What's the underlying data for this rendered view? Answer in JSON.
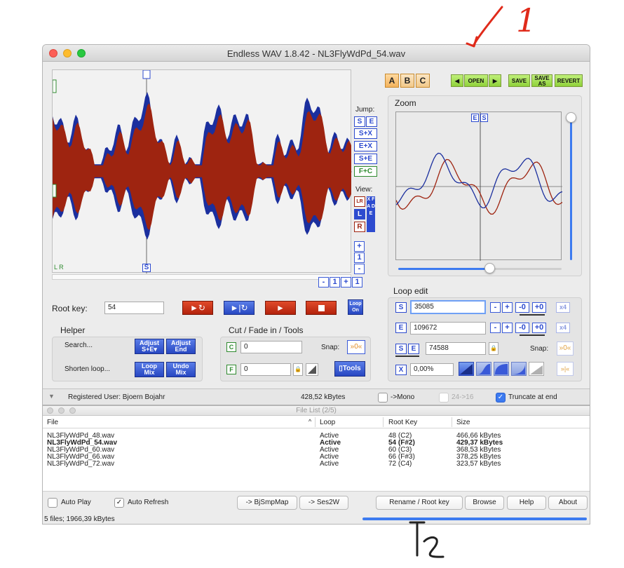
{
  "window": {
    "title": "Endless WAV 1.8.42 - NL3FlyWdPd_54.wav"
  },
  "toolbar": {
    "abc": [
      "A",
      "B",
      "C"
    ],
    "open": "OPEN",
    "save": "SAVE",
    "save_as_line1": "SAVE",
    "save_as_line2": "AS",
    "revert": "REVERT"
  },
  "jump": {
    "label": "Jump:",
    "s": "S",
    "e": "E",
    "sx": "S+X",
    "ex": "E+X",
    "se": "S+E",
    "fc": "F+C"
  },
  "view": {
    "label": "View:",
    "lr": "LR",
    "l": "L",
    "r": "R",
    "xfade": "X F A D E"
  },
  "zoom": {
    "label": "Zoom",
    "marker_e": "E",
    "marker_s": "S"
  },
  "waveform": {
    "marker_s": "S",
    "marker_lr": "L R",
    "zoom_plus": "+",
    "zoom_one": "1",
    "zoom_minus": "-"
  },
  "hzoom": {
    "minus": "-",
    "one": "1",
    "plus": "+",
    "one2": "1"
  },
  "root": {
    "label": "Root key:",
    "value": "54"
  },
  "loop_on": {
    "line1": "Loop",
    "line2": "On"
  },
  "helper": {
    "title": "Helper",
    "search": "Search...",
    "shorten": "Shorten loop...",
    "adjust_se_1": "Adjust",
    "adjust_se_2": "S+E▾",
    "adjust_end_1": "Adjust",
    "adjust_end_2": "End",
    "loop_mix_1": "Loop",
    "loop_mix_2": "Mix",
    "undo_mix_1": "Undo",
    "undo_mix_2": "Mix"
  },
  "cut": {
    "title": "Cut / Fade in / Tools",
    "c_label": "C",
    "c_value": "0",
    "f_label": "F",
    "f_value": "0",
    "snap": "Snap:",
    "tools": "Tools"
  },
  "loop_edit": {
    "title": "Loop edit",
    "s_label": "S",
    "s_value": "35085",
    "e_label": "E",
    "e_value": "109672",
    "len_value": "74588",
    "x_label": "X",
    "x_value": "0,00%",
    "snap": "Snap:",
    "minus": "-",
    "plus": "+",
    "m0": "-0",
    "p0": "+0",
    "x4": "x4"
  },
  "status": {
    "registered": "Registered User: Bjoern Bojahr",
    "size": "428,52 kBytes",
    "mono": "->Mono",
    "bits": "24->16",
    "truncate": "Truncate at end"
  },
  "file_list": {
    "title": "File List (2/5)",
    "columns": [
      "File",
      "Loop",
      "Root Key",
      "Size"
    ],
    "rows": [
      {
        "file": "NL3FlyWdPd_48.wav",
        "loop": "Active",
        "root": "48 (C2)",
        "size": "466,66 kBytes",
        "bold": false
      },
      {
        "file": "NL3FlyWdPd_54.wav",
        "loop": "Active",
        "root": "54 (F#2)",
        "size": "429,37 kBytes",
        "bold": true
      },
      {
        "file": "NL3FlyWdPd_60.wav",
        "loop": "Active",
        "root": "60 (C3)",
        "size": "368,53 kBytes",
        "bold": false
      },
      {
        "file": "NL3FlyWdPd_66.wav",
        "loop": "Active",
        "root": "66 (F#3)",
        "size": "378,25 kBytes",
        "bold": false
      },
      {
        "file": "NL3FlyWdPd_72.wav",
        "loop": "Active",
        "root": "72 (C4)",
        "size": "323,57 kBytes",
        "bold": false
      }
    ],
    "auto_play": "Auto Play",
    "auto_refresh": "Auto Refresh",
    "bjsmpmap": "-> BjSmpMap",
    "ses2w": "-> Ses2W",
    "rename": "Rename / Root key",
    "browse": "Browse",
    "help": "Help",
    "about": "About",
    "summary": "5 files; 1966,39 kBytes"
  },
  "annotations": {
    "one": "1",
    "two": "2"
  },
  "colors": {
    "wave_blue": "#1b2f9e",
    "wave_red": "#9e2410",
    "accent_green": "#8fd13a",
    "accent_blue": "#2d4bcf",
    "button_red": "#c52b12"
  }
}
